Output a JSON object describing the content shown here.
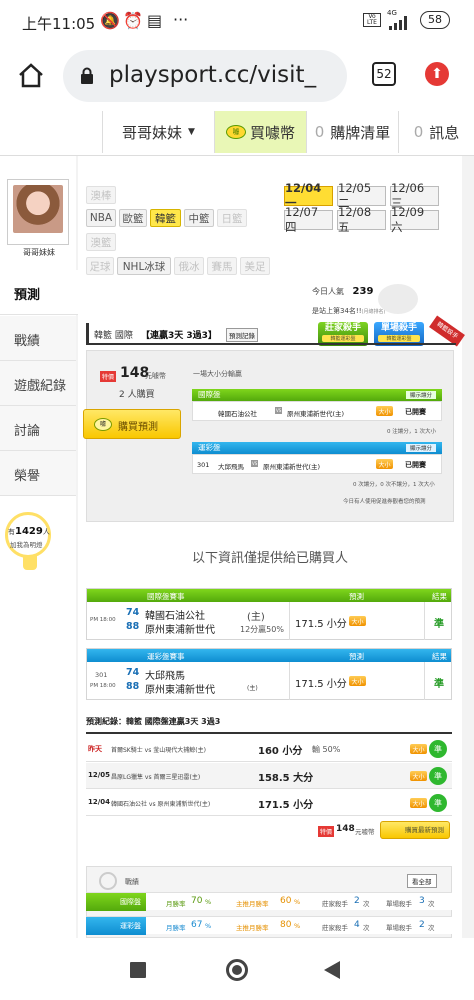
{
  "status": {
    "time": "上午11:05",
    "network": "4G",
    "battery": "58"
  },
  "browser": {
    "url": "playsport.cc/visit_",
    "tab_count": "52"
  },
  "topnav": {
    "user": "哥哥妹妹",
    "buy_coins": "買噱幣",
    "cart_count": "0",
    "cart_label": "購牌清單",
    "msg_count": "0",
    "msg_label": "訊息"
  },
  "sidebar": {
    "username": "哥哥妹妹",
    "items": [
      "預測",
      "戰績",
      "遊戲紀錄",
      "討論",
      "榮譽"
    ],
    "fans_prefix": "有",
    "fans_count": "1429",
    "fans_unit": "人",
    "fans_label": "加我為明燈"
  },
  "sports": {
    "row1": [
      "澳棒"
    ],
    "row2": [
      "NBA",
      "歐籃",
      "韓籃",
      "中籃",
      "日籃"
    ],
    "row3": [
      "澳籃"
    ],
    "row4": [
      "足球",
      "NHL冰球",
      "俄冰",
      "賽馬",
      "美足"
    ]
  },
  "dates": [
    "12/04 一",
    "12/05 二",
    "12/06 三",
    "12/07 四",
    "12/08 五",
    "12/09 六"
  ],
  "popularity": {
    "label": "今日人氣",
    "value": "239",
    "rank": "是站上第34名!!",
    "rank_note": "(月總排名)"
  },
  "badges": {
    "zhuang": "莊家殺手",
    "zhuang_sub": "韓籃運彩盤",
    "danchang": "單場殺手",
    "danchang_sub": "韓籃運彩盤",
    "corner": "韓籃殺手"
  },
  "predict_header": {
    "league": "韓籃 國際",
    "streak": "【連贏3天 3過3】",
    "record_btn": "預測記錄"
  },
  "purchase": {
    "price_tag": "特價",
    "price": "148",
    "price_unit": "元噱幣",
    "buyers": "2 人購買",
    "buy_btn": "購買預測"
  },
  "offer": {
    "desc": "一場大小分輸贏",
    "intl_title": "國際盤",
    "intl_display": "顯示讓分",
    "intl_game": {
      "home": "韓國石油公社",
      "vs": "VS",
      "away": "原州東浦新世代(主)",
      "odds": "大小",
      "status": "已開賽"
    },
    "intl_note": "0 注讓分，1 次大小",
    "sports_title": "運彩盤",
    "sports_display": "顯示讓分",
    "sports_game": {
      "num": "301",
      "home": "大邱飛馬",
      "vs": "VS",
      "away": "原州東浦新世代(主)",
      "odds": "大小",
      "status": "已開賽"
    },
    "sports_note": "0 次讓分，0 次不讓分，1 次大小",
    "footer_note": "今日有人使用促進券觀看您的預測"
  },
  "info_title": "以下資訊僅提供給已購買人",
  "intl_result": {
    "headers": [
      "國際盤賽事",
      "預測",
      "結果"
    ],
    "time": "PM 18:00",
    "n1": "74",
    "n2": "88",
    "team1": "韓國石油公社",
    "team2": "原州東浦新世代",
    "team2_tag": "(主)",
    "note": "12分贏50%",
    "pick": "171.5 小分",
    "odds": "大小",
    "result": "準"
  },
  "sports_result": {
    "headers": [
      "運彩盤賽事",
      "預測",
      "結果"
    ],
    "num": "301",
    "time": "PM 18:00",
    "n1": "74",
    "n2": "88",
    "team1": "大邱飛馬",
    "team2": "原州東浦新世代",
    "team2_tag": "(主)",
    "pick": "171.5 小分",
    "odds": "大小",
    "result": "準"
  },
  "history": {
    "title": "預測紀錄：韓籃 國際盤連贏3天 3過3",
    "rows": [
      {
        "date": "昨天",
        "match": "首爾SK騎士 vs 釜山現代大捕鯨(主)",
        "pick": "160 小分",
        "extra": "輸 50%",
        "odds": "大小",
        "result": "準"
      },
      {
        "date": "12/05",
        "match": "昌原LG獵隼 vs 首爾三星迅雷(主)",
        "pick": "158.5 大分",
        "extra": "",
        "odds": "大小",
        "result": "準"
      },
      {
        "date": "12/04",
        "match": "韓國石油公社 vs 原州東浦新世代(主)",
        "pick": "171.5 小分",
        "extra": "",
        "odds": "大小",
        "result": "準"
      }
    ],
    "price_tag": "特價",
    "price": "148",
    "price_unit": "元噱幣",
    "buy_latest": "購買最新預測"
  },
  "stats": {
    "label": "戰績",
    "view_all": "看全部",
    "rows": [
      {
        "name": "國際盤",
        "win": "月勝率",
        "win_val": "70",
        "main": "主推月勝率",
        "main_val": "60",
        "z": "莊家殺手",
        "z_val": "2",
        "d": "單場殺手",
        "d_val": "3"
      },
      {
        "name": "運彩盤",
        "win": "月勝率",
        "win_val": "67",
        "main": "主推月勝率",
        "main_val": "80",
        "z": "莊家殺手",
        "z_val": "4",
        "d": "單場殺手",
        "d_val": "2"
      }
    ],
    "pct": "%",
    "times": "次"
  },
  "colors": {
    "green": "#53a90c",
    "blue": "#0e8dd0",
    "yellow": "#ffdd33",
    "orange": "#f09200",
    "red": "#e53935"
  }
}
